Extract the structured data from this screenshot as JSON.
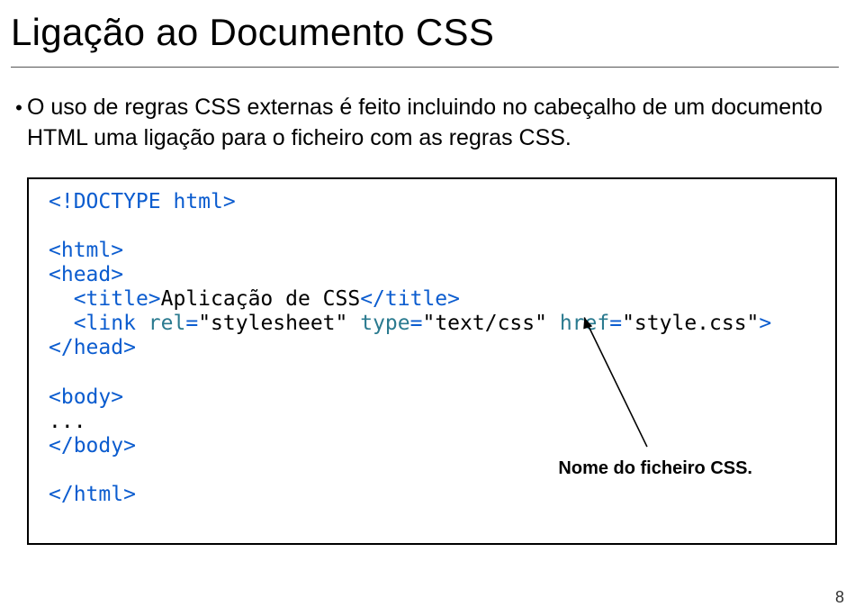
{
  "title": "Ligação ao Documento CSS",
  "bullet": {
    "dot": "•",
    "text": "O uso de regras CSS externas é feito incluindo no cabeçalho de um documento HTML uma ligação para o ficheiro com as regras CSS."
  },
  "code": {
    "doctype": "<!DOCTYPE html>",
    "html_open": "<html>",
    "head_open": "<head>",
    "indent": "  ",
    "title_open": "<title>",
    "title_text": "Aplicação de CSS",
    "title_close": "</title>",
    "link_part1": "<link ",
    "link_rel_attr": "rel",
    "link_eq": "=",
    "link_rel_val": "\"stylesheet\"",
    "link_space": " ",
    "link_type_attr": "type",
    "link_type_val": "\"text/css\"",
    "link_href_attr": "href",
    "link_href_val": "\"style.css\"",
    "link_close": ">",
    "head_close": "</head>",
    "body_open": "<body>",
    "body_ellipsis": "...",
    "body_close": "</body>",
    "html_close": "</html>"
  },
  "annotation": "Nome do ficheiro CSS.",
  "page_number": "8"
}
